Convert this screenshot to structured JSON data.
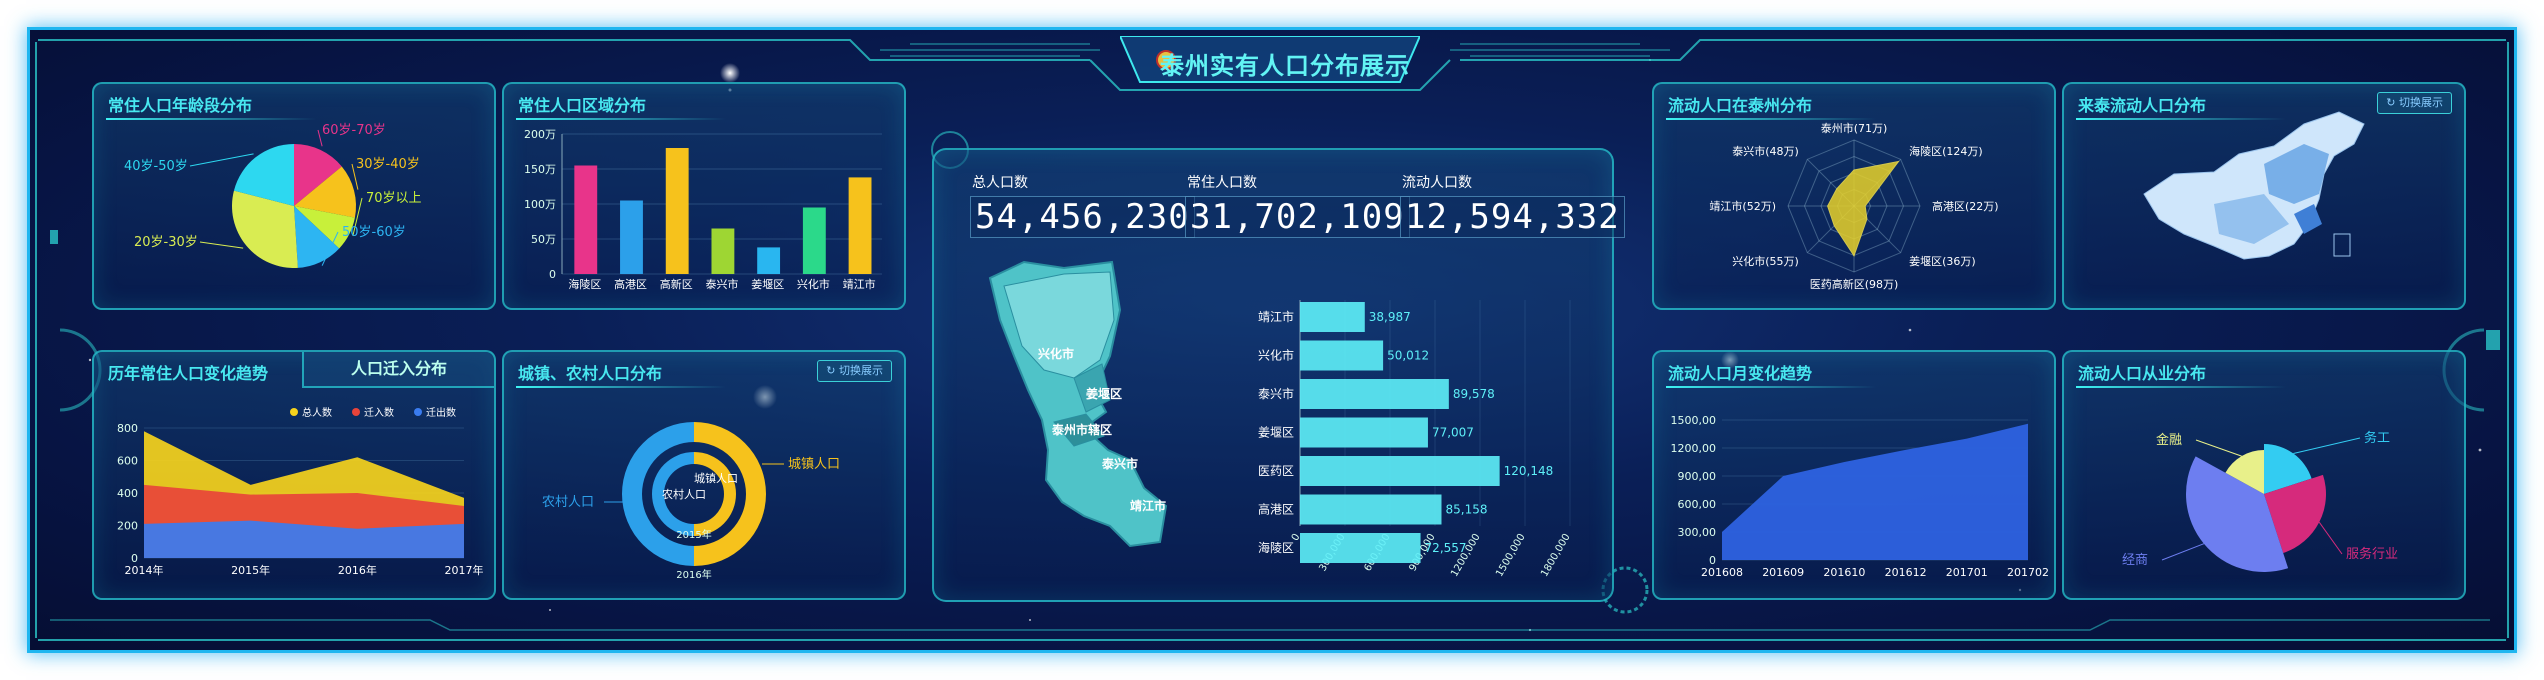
{
  "header": {
    "title": "泰州实有人口分布展示",
    "emblem": "police-emblem"
  },
  "age_panel": {
    "title": "常住人口年龄段分布",
    "chart_data": {
      "type": "pie",
      "slices": [
        {
          "label": "60岁-70岁",
          "value": 14,
          "color": "#e8348a"
        },
        {
          "label": "30岁-40岁",
          "value": 14,
          "color": "#f6c21c"
        },
        {
          "label": "70岁以上",
          "value": 9,
          "color": "#c8f03a"
        },
        {
          "label": "50岁-60岁",
          "value": 12,
          "color": "#2db5f2"
        },
        {
          "label": "20岁-30岁",
          "value": 30,
          "color": "#d9ec52"
        },
        {
          "label": "40岁-50岁",
          "value": 21,
          "color": "#2dd8f0"
        }
      ]
    }
  },
  "region_panel": {
    "title": "常住人口区域分布",
    "chart_data": {
      "type": "bar",
      "ylim": [
        0,
        200
      ],
      "yticks": [
        "200万",
        "150万",
        "100万",
        "50万",
        "0"
      ],
      "categories": [
        "海陵区",
        "高港区",
        "高新区",
        "泰兴市",
        "姜堰区",
        "兴化市",
        "靖江市"
      ],
      "values": [
        155,
        105,
        180,
        65,
        38,
        95,
        138
      ],
      "colors": [
        "#e8348a",
        "#2ca0ea",
        "#f6c21c",
        "#9ed633",
        "#29b6f0",
        "#2bd98a",
        "#f6c21c"
      ]
    }
  },
  "trend_panel": {
    "title": "历年常住人口变化趋势",
    "tab2": "人口迁入分布",
    "chart_data": {
      "type": "area",
      "x": [
        "2014年",
        "2015年",
        "2016年",
        "2017年"
      ],
      "ylim": [
        0,
        800
      ],
      "yticks": [
        "800",
        "600",
        "400",
        "200",
        "0"
      ],
      "series": [
        {
          "name": "总人数",
          "values": [
            780,
            450,
            620,
            370
          ],
          "color": "#f6d21c"
        },
        {
          "name": "迁入数",
          "values": [
            450,
            390,
            400,
            320
          ],
          "color": "#e8443a"
        },
        {
          "name": "迁出数",
          "values": [
            210,
            230,
            180,
            210
          ],
          "color": "#3a7cf0"
        }
      ]
    }
  },
  "urban_panel": {
    "title": "城镇、农村人口分布",
    "switch": "切换展示",
    "chart_data": {
      "type": "pie",
      "rings": [
        {
          "year": "2016年",
          "urban": 50,
          "rural": 50
        },
        {
          "year": "2015年",
          "urban": 50,
          "rural": 50
        }
      ],
      "urban_label": "城镇人口",
      "rural_label": "农村人口",
      "urban_color": "#f6c21c",
      "rural_color": "#2ca0ea"
    }
  },
  "center": {
    "total_label": "总人口数",
    "total": "54,456,230",
    "resident_label": "常住人口数",
    "resident": "31,702,109",
    "floating_label": "流动人口数",
    "floating": "12,594,332",
    "map_labels": [
      "兴化市",
      "姜堰区",
      "泰州市辖区",
      "泰兴市",
      "靖江市"
    ],
    "chart_data": {
      "type": "bar",
      "orientation": "horizontal",
      "xlim": [
        0,
        1800000
      ],
      "xticks": [
        "0",
        "300,000",
        "600,000",
        "900,000",
        "1200,000",
        "1500,000",
        "1800,000"
      ],
      "categories": [
        "靖江市",
        "兴化市",
        "泰兴市",
        "姜堰区",
        "医药区",
        "高港区",
        "海陵区"
      ],
      "values": [
        38987,
        50012,
        89578,
        77007,
        120148,
        85158,
        72557
      ],
      "value_labels": [
        "38,987",
        "50,012",
        "89,578",
        "77,007",
        "120,148",
        "85,158",
        "72,557"
      ]
    }
  },
  "radar_panel": {
    "title": "流动人口在泰州分布",
    "chart_data": {
      "type": "radar",
      "axes": [
        "泰州市(71万)",
        "海陵区(124万)",
        "高港区(22万)",
        "姜堰区(36万)",
        "医药高新区(98万)",
        "兴化市(55万)",
        "靖江市(52万)",
        "泰兴市(48万)"
      ],
      "values": [
        71,
        124,
        22,
        36,
        98,
        55,
        52,
        48
      ],
      "max": 130
    }
  },
  "map_panel": {
    "title": "来泰流动人口分布",
    "switch": "切换展示"
  },
  "monthly_panel": {
    "title": "流动人口月变化趋势",
    "chart_data": {
      "type": "area",
      "x": [
        "201608",
        "201609",
        "201610",
        "201612",
        "201701",
        "201702"
      ],
      "ylim": [
        0,
        1500
      ],
      "yticks": [
        "1500,00",
        "1200,00",
        "900,00",
        "600,00",
        "300,00",
        "0"
      ],
      "values": [
        300,
        900,
        1050,
        1180,
        1300,
        1460
      ]
    }
  },
  "job_panel": {
    "title": "流动人口从业分布",
    "chart_data": {
      "type": "pie",
      "slices": [
        {
          "label": "务工",
          "value": 20,
          "color": "#33ccf2"
        },
        {
          "label": "服务行业",
          "value": 25,
          "color": "#d62a7c"
        },
        {
          "label": "经商",
          "value": 38,
          "color": "#6d7ef0"
        },
        {
          "label": "金融",
          "value": 17,
          "color": "#e8f08a"
        }
      ]
    }
  }
}
